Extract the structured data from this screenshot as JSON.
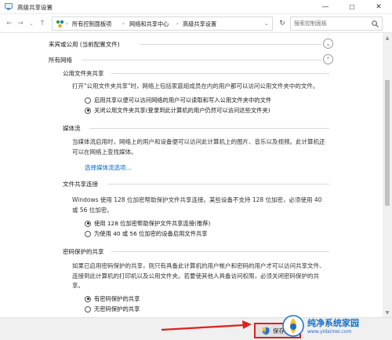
{
  "window": {
    "title": "高级共享设置",
    "minimize_glyph": "—",
    "maximize_glyph": "☐",
    "close_glyph": "✕"
  },
  "nav": {
    "back_glyph": "←",
    "forward_glyph": "→",
    "dropdown_glyph": "⌄",
    "up_glyph": "↑",
    "breadcrumbs": [
      "所有控制面板项",
      "网络和共享中心",
      "高级共享设置"
    ],
    "separator": "›",
    "refresh_glyph": "↻",
    "search_placeholder": "搜索控制面板"
  },
  "sections": {
    "guest": {
      "label": "来宾或公用 (当前配置文件)",
      "chevron": "⌄"
    },
    "all_networks": {
      "label": "所有网络",
      "chevron": "⌃"
    }
  },
  "public_folder": {
    "title": "公用文件夹共享",
    "description": "打开\"公用文件夹共享\"时，网络上包括家庭组成员在内的用户都可以访问公用文件夹中的文件。",
    "options": [
      {
        "label": "启用共享以便可以访问网络的用户可以读取和写入公用文件夹中的文件",
        "checked": false
      },
      {
        "label": "关闭公用文件夹共享(登录到此计算机的用户仍然可以访问这些文件夹)",
        "checked": true
      }
    ]
  },
  "media_streaming": {
    "title": "媒体流",
    "description": "当媒体流启用时，网络上的用户和设备便可以访问此计算机上的图片、音乐以及视频。此计算机还可以在网络上查找媒体。",
    "link": "选择媒体流选项..."
  },
  "file_sharing": {
    "title": "文件共享连接",
    "description": "Windows 使用 128 位加密帮助保护文件共享连接。某些设备不支持 128 位加密，必须使用 40 或 56 位加密。",
    "options": [
      {
        "label": "使用 128 位加密帮助保护文件共享连接(推荐)",
        "checked": true
      },
      {
        "label": "为使用 40 或 56 位加密的设备启用文件共享",
        "checked": false
      }
    ]
  },
  "password_sharing": {
    "title": "密码保护的共享",
    "description": "如果已启用密码保护的共享，则只有具备此计算机的用户帐户和密码的用户才可以访问共享文件、连接到此计算机的打印机以及公用文件夹。若要使其他人具备访问权限，必须关闭密码保护的共享。",
    "options": [
      {
        "label": "有密码保护的共享",
        "checked": true
      },
      {
        "label": "无密码保护的共享",
        "checked": false
      }
    ]
  },
  "footer": {
    "save_label": "保存更改"
  },
  "watermark": {
    "title": "纯净系统家园",
    "url": "www.yidaimei.com"
  },
  "colors": {
    "link": "#0066cc",
    "highlight_red": "#e02020",
    "watermark_blue": "#1a6fc4"
  }
}
